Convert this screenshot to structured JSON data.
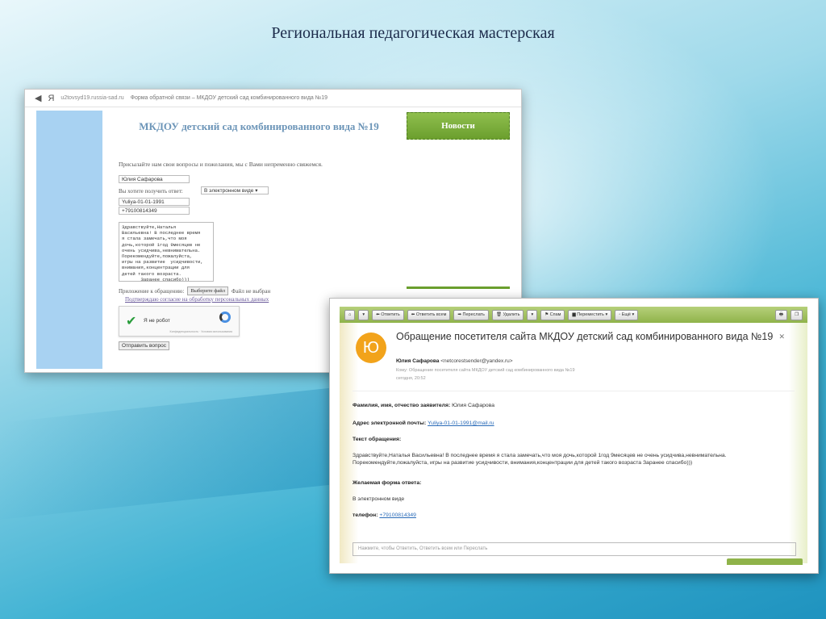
{
  "slide": {
    "title": "Региональная педагогическая мастерская"
  },
  "browser": {
    "nav_back": "◀",
    "nav_ya": "Я",
    "url": "u2tovsyd19.russia-sad.ru",
    "page_title": "Форма обратной связи – МКДОУ детский сад комбинированного вида №19"
  },
  "site": {
    "title": "МКДОУ детский сад комбинированного вида №19",
    "news_tab": "Новости"
  },
  "form": {
    "intro": "Присылайте нам свои вопросы и пожелания, мы с Вами непременно свяжемся.",
    "name_value": "Юлия Сафарова",
    "reply_label": "Вы хотите получить ответ:",
    "reply_selected": "В электронном виде ▾",
    "email_value": "Yuliya-01-01-1991",
    "phone_value": "+79100814349",
    "message_value": "Здравствуйте,Наталья\nВасильевна! В последнее время\nя стала замечать,что моя\nдочь,которой 1год 9месяцев не\nочень усидчива,невнимательна.\nПорекомендуйте,пожалуйста,\nигры на развитие  усидчивости,\nвнимания,концентрации для\nдетей такого возраста.\n       Заранее спасибо)))",
    "attach_label": "Приложение к обращению:",
    "attach_button": "Выберите файл",
    "attach_status": "Файл не выбран",
    "consent_link": "Подтверждаю согласие на обработку персональных данных",
    "captcha_label": "Я не робот",
    "captcha_fine": "Конфиденциальность · Условия использования",
    "submit_label": "Отправить вопрос"
  },
  "mail": {
    "toolbar": {
      "home": "⌂",
      "menu": "▾",
      "reply": "⬅ Ответить",
      "reply_all": "⬅ Ответить всем",
      "forward": "➡ Переслать",
      "delete": "🗑 Удалить",
      "delete_more": "▾",
      "spam": "⚑ Спам",
      "move": "▆ Переместить ▾",
      "more": "◦ Ещё ▾",
      "print": "🖶",
      "window": "❐"
    },
    "avatar_letter": "Ю",
    "subject": "Обращение посетителя сайта МКДОУ детский сад комбинированного вида №19",
    "close": "✕",
    "sender_name": "Юлия Сафарова",
    "sender_email": "<netcorestsender@yandex.ru>",
    "to_line": "Кому: Обращение посетителя сайта МКДОУ детский сад комбинированного вида №19",
    "time": "сегодня, 20:52",
    "fio_label": "Фамилия, имя, отчество заявителя:",
    "fio_value": "Юлия Сафарова",
    "email_label": "Адрес электронной почты:",
    "email_value": "Yuliya-01-01-1991@mail.ru",
    "text_label": "Текст обращения:",
    "text_value": "Здравствуйте,Наталья Васильевна! В последнее время я стала замечать,что моя дочь,которой 1год 9месяцев не очень усидчива,невнимательна. Порекомендуйте,пожалуйста, игры на развитие усидчивости, внимания,концентрации для детей такого возраста Заранее спасибо)))",
    "form_label": "Желаемая форма ответа:",
    "form_value": "В электронном виде",
    "phone_label": "телефон:",
    "phone_value": "+79100814349",
    "reply_placeholder": "Нажмите, чтобы Ответить, Ответить всем или Переслать"
  }
}
